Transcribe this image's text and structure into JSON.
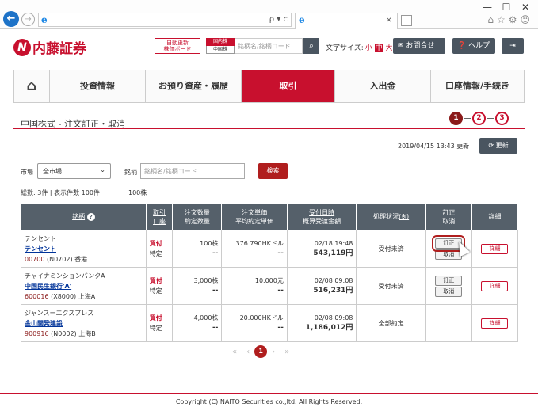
{
  "browser": {
    "back_icon": "←",
    "forward_icon": "→",
    "address_tools": "ρ ▾ c",
    "tab_close": "×",
    "window_controls": [
      "—",
      "☐",
      "✕"
    ],
    "right_icons": "⌂☆⚙☺"
  },
  "header": {
    "logo_mark": "N",
    "logo_text": "内藤証券",
    "auto_board": [
      "自動更新",
      "株価ボード"
    ],
    "stock_tabs": {
      "domestic": "国内株",
      "china": "中国株"
    },
    "search_placeholder": "銘柄名/銘柄コード",
    "search_icon": "🔍",
    "font_size_label": "文字サイズ:",
    "font_sizes": {
      "small": "小",
      "medium": "中",
      "large": "大"
    },
    "contact": "✉ お問合せ",
    "help": "❓ ヘルプ",
    "logout": "⇥"
  },
  "nav": {
    "home_icon": "⌂",
    "items": [
      "投資情報",
      "お預り資産・履歴",
      "取引",
      "入出金",
      "口座情報/手続き"
    ],
    "active_index": 2
  },
  "page": {
    "title": "中国株式 - 注文訂正・取消",
    "steps": [
      "1",
      "2",
      "3"
    ],
    "active_step": 0,
    "updated": "2019/04/15 13:43 更新",
    "refresh": "⟳ 更新"
  },
  "filters": {
    "market_label": "市場",
    "market_value": "全市場",
    "name_label": "銘柄",
    "name_placeholder": "銘柄名/銘柄コード",
    "search_button": "検索"
  },
  "summary": {
    "text": "総数: 3件 | 表示件数 100件",
    "extra": "100株"
  },
  "table": {
    "headers": {
      "name": "銘柄",
      "name_icon": "?",
      "account": [
        "取引",
        "口座"
      ],
      "qty": [
        "注文数量",
        "約定数量"
      ],
      "price": [
        "注文単価",
        "平均約定単価"
      ],
      "date": [
        "受付日時",
        "概算受渡金額"
      ],
      "status": "処理状況",
      "status_note": "(※)",
      "action": [
        "訂正",
        "取消"
      ],
      "detail": "詳細"
    },
    "rows": [
      {
        "name_kana": "テンセント",
        "name_link": "テンセント",
        "code": "00700",
        "code_sub": "(N0702) 香港",
        "side": "買付",
        "account": "特定",
        "qty": "100株",
        "filled": "--",
        "price": "376.790HKドル",
        "avg_price": "--",
        "date": "02/18 19:48",
        "amount": "543,119円",
        "status": "受付未済",
        "edit": "訂正",
        "cancel": "取消",
        "detail": "詳細"
      },
      {
        "name_kana": "チャイナミンションバンクA",
        "name_link": "中国民生銀行'A'",
        "code": "600016",
        "code_sub": "(X8000) 上海A",
        "side": "買付",
        "account": "特定",
        "qty": "3,000株",
        "filled": "--",
        "price": "10.000元",
        "avg_price": "--",
        "date": "02/08 09:08",
        "amount": "516,231円",
        "status": "受付未済",
        "edit": "訂正",
        "cancel": "取消",
        "detail": "詳細"
      },
      {
        "name_kana": "ジャンスーエクスプレス",
        "name_link": "金山開発建設",
        "code": "900916",
        "code_sub": "(N0002) 上海B",
        "side": "買付",
        "account": "特定",
        "qty": "4,000株",
        "filled": "--",
        "price": "20.000HKドル",
        "avg_price": "--",
        "date": "02/08 09:08",
        "amount": "1,186,012円",
        "status": "全部約定",
        "edit": "",
        "cancel": "",
        "detail": "詳細"
      }
    ]
  },
  "pager": {
    "first": "«",
    "prev": "‹",
    "current": "1",
    "next": "›",
    "last": "»"
  },
  "footer": {
    "copyright": "Copyright (C) NAITO Securities co.,ltd. All Rights Reserved."
  }
}
